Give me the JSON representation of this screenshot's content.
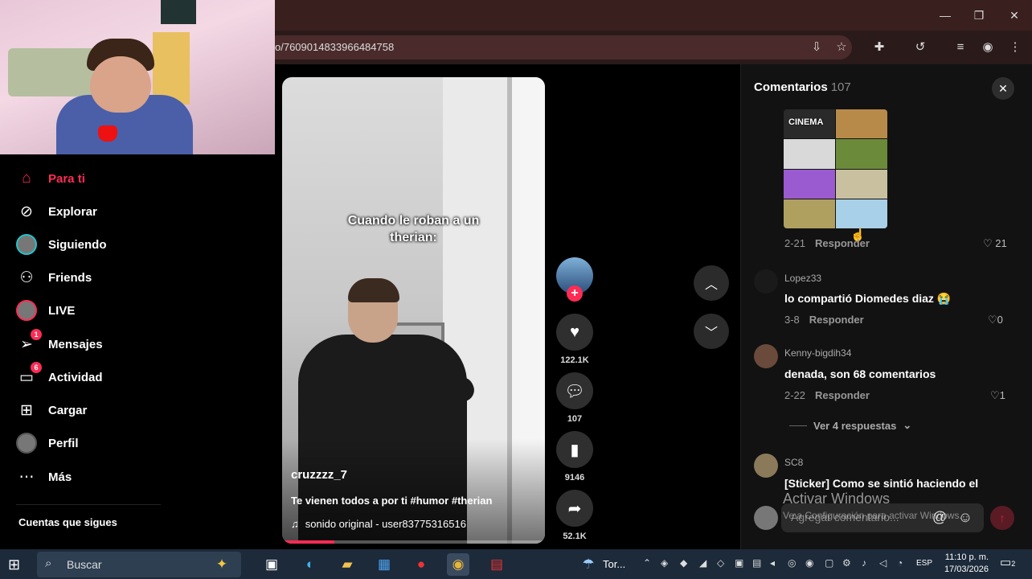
{
  "browser": {
    "url": "o/7609014833966484758",
    "window_controls": {
      "minimize": "—",
      "restore": "❐",
      "close": "✕"
    }
  },
  "nav": {
    "items": [
      {
        "label": "Para ti",
        "icon": "home-icon",
        "active": true
      },
      {
        "label": "Explorar",
        "icon": "compass-icon"
      },
      {
        "label": "Siguiendo",
        "icon": "following-avatar-icon"
      },
      {
        "label": "Friends",
        "icon": "friends-icon"
      },
      {
        "label": "LIVE",
        "icon": "live-avatar-icon"
      },
      {
        "label": "Mensajes",
        "icon": "send-icon",
        "badge": "1"
      },
      {
        "label": "Actividad",
        "icon": "inbox-icon",
        "badge": "6"
      },
      {
        "label": "Cargar",
        "icon": "upload-icon"
      },
      {
        "label": "Perfil",
        "icon": "profile-avatar-icon"
      },
      {
        "label": "Más",
        "icon": "more-icon"
      }
    ],
    "following_title": "Cuentas que sigues"
  },
  "video": {
    "caption": "Cuando le roban a un therian:",
    "username": "cruzzzz_7",
    "description": "Te vienen todos a por ti #humor #therian",
    "sound": "sonido original - user83775316516",
    "progress": 0.2
  },
  "actions": {
    "likes": "122.1K",
    "comments": "107",
    "saves": "9146",
    "shares": "52.1K"
  },
  "comments_panel": {
    "title": "Comentarios",
    "count": "107",
    "collage_label": "CINEMA",
    "comments": [
      {
        "date": "2-21",
        "reply": "Responder",
        "likes": "21"
      },
      {
        "user": "Lopez33",
        "text": "lo compartió Diomedes diaz 😭",
        "date": "3-8",
        "reply": "Responder",
        "likes": "0"
      },
      {
        "user": "Kenny-bigdih34",
        "text": "denada, son 68 comentarios",
        "date": "2-22",
        "reply": "Responder",
        "likes": "1"
      },
      {
        "user": "SC8",
        "text": "[Sticker] Como se sintió haciendo el"
      }
    ],
    "view_replies": "Ver 4 respuestas",
    "input_placeholder": "Agregar comentario...",
    "watermark": "Activar Windows",
    "watermark_sub": "Ve a Configuración para activar Windows."
  },
  "taskbar": {
    "search_label": "Buscar",
    "weather": "Tor...",
    "language": "ESP",
    "time": "11:10 p. m.",
    "date": "17/03/2026",
    "notifications": "2"
  },
  "colors": {
    "accent": "#fe2c55",
    "background": "#000000",
    "panel": "#121212"
  }
}
